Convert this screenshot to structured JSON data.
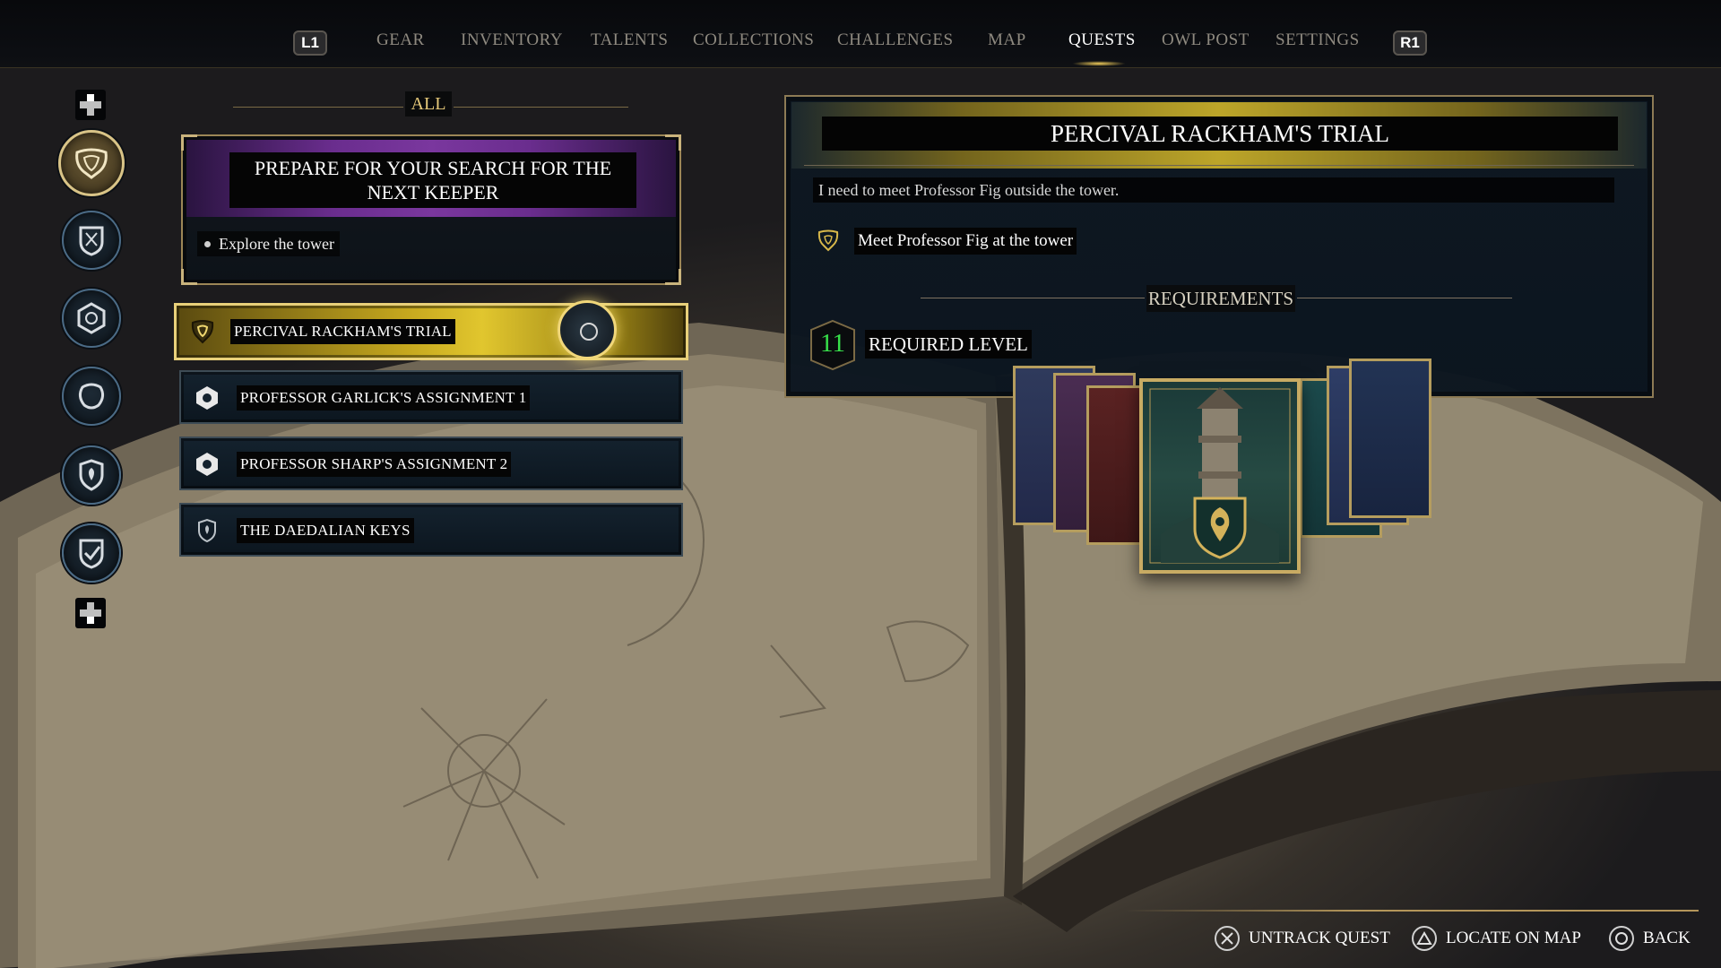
{
  "nav": {
    "left_bumper": "L1",
    "right_bumper": "R1",
    "items": [
      {
        "label": "GEAR"
      },
      {
        "label": "INVENTORY"
      },
      {
        "label": "TALENTS"
      },
      {
        "label": "COLLECTIONS"
      },
      {
        "label": "CHALLENGES"
      },
      {
        "label": "MAP"
      },
      {
        "label": "QUESTS"
      },
      {
        "label": "OWL POST"
      },
      {
        "label": "SETTINGS"
      }
    ],
    "active": "QUESTS"
  },
  "filter": {
    "label": "ALL"
  },
  "categories": [
    {
      "icon": "main-quest-crest-icon",
      "active": true
    },
    {
      "icon": "house-crest-icon"
    },
    {
      "icon": "assignment-icon"
    },
    {
      "icon": "relationship-icon"
    },
    {
      "icon": "side-quest-shield-icon"
    },
    {
      "icon": "completed-quest-icon"
    }
  ],
  "main_quest": {
    "title": "PREPARE FOR YOUR SEARCH FOR THE NEXT KEEPER",
    "objective": "Explore the tower"
  },
  "quests": [
    {
      "label": "PERCIVAL RACKHAM'S TRIAL",
      "icon": "main-quest-icon",
      "selected": true
    },
    {
      "label": "PROFESSOR GARLICK'S ASSIGNMENT 1",
      "icon": "assignment-icon"
    },
    {
      "label": "PROFESSOR SHARP'S ASSIGNMENT 2",
      "icon": "assignment-icon"
    },
    {
      "label": "THE DAEDALIAN KEYS",
      "icon": "side-quest-icon"
    }
  ],
  "detail": {
    "title": "PERCIVAL RACKHAM'S TRIAL",
    "description": "I need to meet Professor Fig outside the tower.",
    "step": "Meet Professor Fig at the tower",
    "requirements_label": "REQUIREMENTS",
    "required_level_value": "11",
    "required_level_label": "REQUIRED LEVEL"
  },
  "prompts": [
    {
      "button": "cross",
      "label": "UNTRACK QUEST"
    },
    {
      "button": "triangle",
      "label": "LOCATE ON MAP"
    },
    {
      "button": "circle",
      "label": "BACK"
    }
  ],
  "colors": {
    "accent_gold": "#e1c62e",
    "main_quest_purple": "#7a379e",
    "level_green": "#37e04a",
    "panel_navy": "#0e1822"
  }
}
